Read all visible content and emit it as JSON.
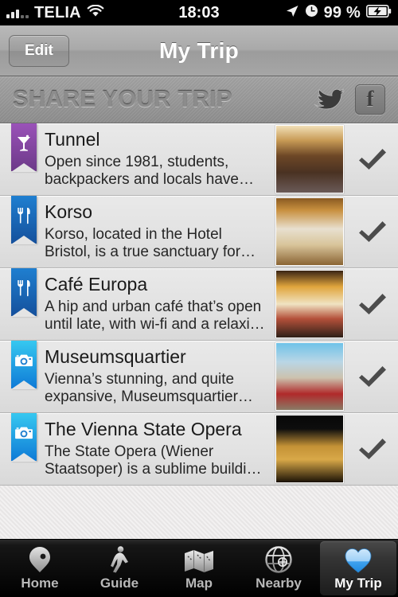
{
  "status_bar": {
    "carrier": "TELIA",
    "wifi_icon": "wifi-icon",
    "time": "18:03",
    "location_icon": "location-arrow-icon",
    "alarm_icon": "alarm-clock-icon",
    "battery_percent": "99 %",
    "battery_icon": "battery-charging-icon"
  },
  "nav_bar": {
    "edit_label": "Edit",
    "title": "My Trip"
  },
  "share_bar": {
    "title": "SHARE YOUR TRIP",
    "twitter_icon": "twitter-bird-icon",
    "facebook_icon": "facebook-icon",
    "facebook_letter": "f"
  },
  "colors": {
    "ribbon_purple_top": "#9a52b8",
    "ribbon_purple_bottom": "#6c3a88",
    "ribbon_blue_top": "#1f7fd0",
    "ribbon_blue_bottom": "#15509c",
    "ribbon_cyan_top": "#36c8f0",
    "ribbon_cyan_bottom": "#0f7ad6",
    "check_gray": "#4c4c4c",
    "tab_active_blue": "#49a7ee"
  },
  "list": {
    "rows": [
      {
        "title": "Tunnel",
        "description": "Open since 1981, students, backpackers and locals have…",
        "category_icon": "cocktail-icon",
        "ribbon_color": "purple",
        "checked": true,
        "thumb_name": "tunnel-thumbnail"
      },
      {
        "title": "Korso",
        "description": "Korso, located in the Hotel Bristol, is a true sanctuary for…",
        "category_icon": "restaurant-icon",
        "ribbon_color": "blue",
        "checked": true,
        "thumb_name": "korso-thumbnail"
      },
      {
        "title": "Café Europa",
        "description": "A hip and urban café that’s open until late, with wi-fi and a relaxi…",
        "category_icon": "restaurant-icon",
        "ribbon_color": "blue",
        "checked": true,
        "thumb_name": "cafe-europa-thumbnail"
      },
      {
        "title": "Museumsquartier",
        "description": "Vienna’s stunning, and quite expansive,  Museumsquartier…",
        "category_icon": "camera-icon",
        "ribbon_color": "cyan",
        "checked": true,
        "thumb_name": "museumsquartier-thumbnail"
      },
      {
        "title": "The Vienna State Opera",
        "description": "The State Opera (Wiener Staatsoper) is a sublime buildi…",
        "category_icon": "camera-icon",
        "ribbon_color": "cyan",
        "checked": true,
        "thumb_name": "vienna-state-opera-thumbnail"
      }
    ]
  },
  "tab_bar": {
    "tabs": [
      {
        "label": "Home",
        "icon": "map-pin-icon",
        "active": false
      },
      {
        "label": "Guide",
        "icon": "walking-person-icon",
        "active": false
      },
      {
        "label": "Map",
        "icon": "folded-map-icon",
        "active": false
      },
      {
        "label": "Nearby",
        "icon": "radar-globe-icon",
        "active": false
      },
      {
        "label": "My Trip",
        "icon": "heart-icon",
        "active": true
      }
    ]
  }
}
